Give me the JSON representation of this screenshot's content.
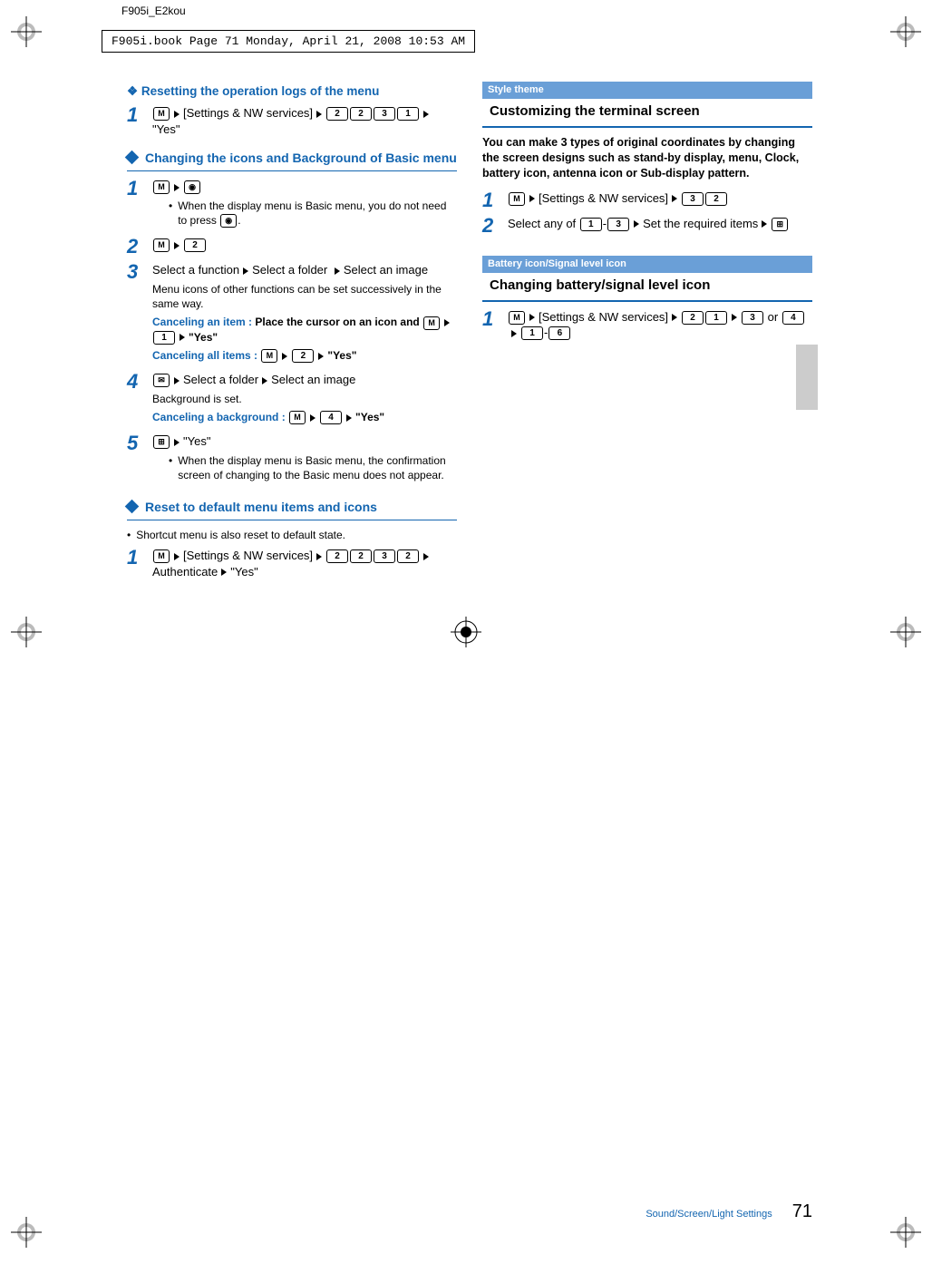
{
  "header": {
    "doc_id": "F905i_E2kou",
    "bookline": "F905i.book  Page 71  Monday, April 21, 2008  10:53 AM"
  },
  "left": {
    "sec1_prefix": "❖",
    "sec1_title": "Resetting the operation logs of the menu",
    "sec1_s1_num": "1",
    "sec1_s1_key_mn": "MENU",
    "sec1_s1_text1": "[Settings & NW services]",
    "sec1_s1_k1": "2",
    "sec1_s1_k2": "2",
    "sec1_s1_k3": "3",
    "sec1_s1_k4": "1",
    "sec1_s1_text2": "\"Yes\"",
    "sec2_title": "Changing the icons and Background of Basic menu",
    "sec2_s1_num": "1",
    "sec2_s1_key_mn": "M",
    "sec2_s1_key_cam": "📷",
    "sec2_s1_bullet": "When the display menu is Basic menu, you do not need to press",
    "sec2_s1_bullet_end": ".",
    "sec2_s2_num": "2",
    "sec2_s2_key_mn": "M",
    "sec2_s2_k1": "2",
    "sec2_s3_num": "3",
    "sec2_s3_t1": "Select a function",
    "sec2_s3_t2": "Select a folder",
    "sec2_s3_t3": "Select an image",
    "sec2_s3_note1": "Menu icons of other functions can be set successively in the same way.",
    "sec2_s3_cancel_item_lbl": "Canceling an item :",
    "sec2_s3_cancel_item_txt": "Place the cursor on an icon and",
    "sec2_s3_cancel_item_k1": "1",
    "sec2_s3_cancel_item_yes": "\"Yes\"",
    "sec2_s3_cancel_all_lbl": "Canceling all items :",
    "sec2_s3_cancel_all_k1": "2",
    "sec2_s3_cancel_all_yes": "\"Yes\"",
    "sec2_s4_num": "4",
    "sec2_s4_mail": "✉",
    "sec2_s4_t1": "Select a folder",
    "sec2_s4_t2": "Select an image",
    "sec2_s4_note": "Background is set.",
    "sec2_s4_cancel_lbl": "Canceling a background :",
    "sec2_s4_cancel_k1": "4",
    "sec2_s4_cancel_yes": "\"Yes\"",
    "sec2_s5_num": "5",
    "sec2_s5_key": "⊞",
    "sec2_s5_t1": "\"Yes\"",
    "sec2_s5_bullet": "When the display menu is Basic menu, the confirmation screen of changing to the Basic menu does not appear.",
    "sec3_title": "Reset to default menu items and icons",
    "sec3_bullet": "Shortcut menu is also reset to default state.",
    "sec3_s1_num": "1",
    "sec3_s1_text1": "[Settings & NW services]",
    "sec3_s1_k1": "2",
    "sec3_s1_k2": "2",
    "sec3_s1_k3": "3",
    "sec3_s1_k4": "2",
    "sec3_s1_text2": "Authenticate",
    "sec3_s1_text3": "\"Yes\""
  },
  "right": {
    "tag1": "Style theme",
    "h1": "Customizing the terminal screen",
    "intro": "You can make 3 types of original coordinates by changing the screen designs such as stand-by display, menu, Clock, battery icon, antenna icon or Sub-display pattern.",
    "r_s1_num": "1",
    "r_s1_text": "[Settings & NW services]",
    "r_s1_k1": "3",
    "r_s1_k2": "2",
    "r_s2_num": "2",
    "r_s2_t1": "Select any of",
    "r_s2_k1": "1",
    "r_s2_dash": "-",
    "r_s2_k2": "3",
    "r_s2_t2": "Set the required items",
    "tag2": "Battery icon/Signal level icon",
    "h2": "Changing battery/signal level icon",
    "r2_s1_num": "1",
    "r2_s1_text": "[Settings & NW services]",
    "r2_s1_k1": "2",
    "r2_s1_k2": "1",
    "r2_s1_k3": "3",
    "r2_s1_or": "or",
    "r2_s1_k4": "4",
    "r2_s1_k5": "1",
    "r2_s1_dash": "-",
    "r2_s1_k6": "6"
  },
  "footer": {
    "section": "Sound/Screen/Light Settings",
    "pageno": "71"
  }
}
